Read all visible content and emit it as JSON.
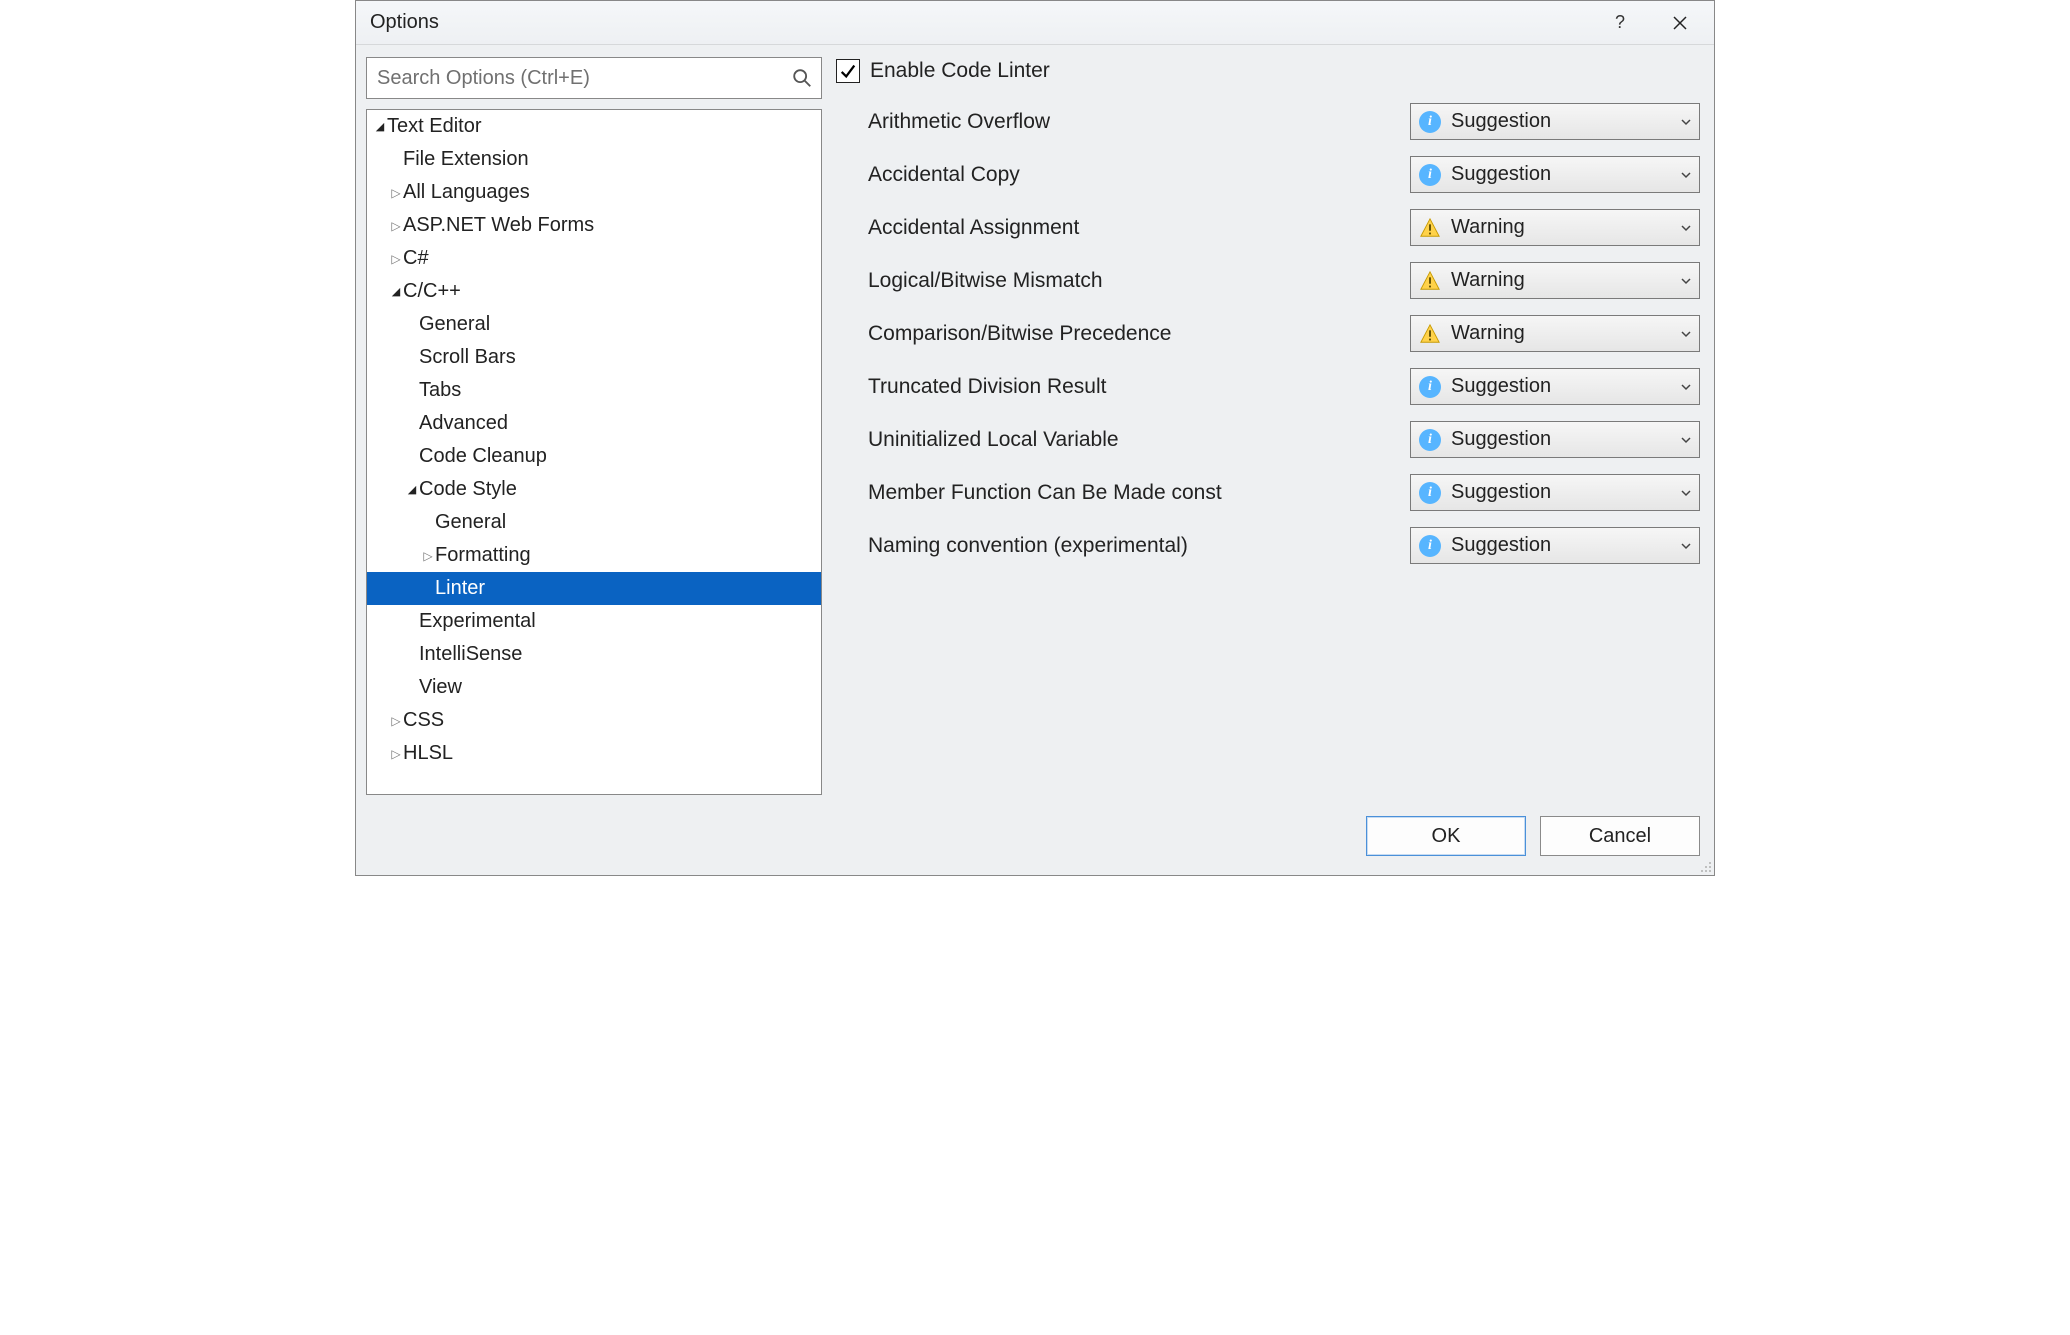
{
  "window": {
    "title": "Options",
    "help_tooltip": "?",
    "close_tooltip": "×"
  },
  "search": {
    "placeholder": "Search Options (Ctrl+E)",
    "value": ""
  },
  "tree": [
    {
      "label": "Text Editor",
      "indent": 0,
      "arrow": "expanded"
    },
    {
      "label": "File Extension",
      "indent": 1,
      "arrow": "none"
    },
    {
      "label": "All Languages",
      "indent": 1,
      "arrow": "collapsed"
    },
    {
      "label": "ASP.NET Web Forms",
      "indent": 1,
      "arrow": "collapsed"
    },
    {
      "label": "C#",
      "indent": 1,
      "arrow": "collapsed"
    },
    {
      "label": "C/C++",
      "indent": 1,
      "arrow": "expanded"
    },
    {
      "label": "General",
      "indent": 2,
      "arrow": "none"
    },
    {
      "label": "Scroll Bars",
      "indent": 2,
      "arrow": "none"
    },
    {
      "label": "Tabs",
      "indent": 2,
      "arrow": "none"
    },
    {
      "label": "Advanced",
      "indent": 2,
      "arrow": "none"
    },
    {
      "label": "Code Cleanup",
      "indent": 2,
      "arrow": "none"
    },
    {
      "label": "Code Style",
      "indent": 2,
      "arrow": "expanded"
    },
    {
      "label": "General",
      "indent": 3,
      "arrow": "none"
    },
    {
      "label": "Formatting",
      "indent": 3,
      "arrow": "collapsed"
    },
    {
      "label": "Linter",
      "indent": 3,
      "arrow": "none",
      "selected": true
    },
    {
      "label": "Experimental",
      "indent": 2,
      "arrow": "none"
    },
    {
      "label": "IntelliSense",
      "indent": 2,
      "arrow": "none"
    },
    {
      "label": "View",
      "indent": 2,
      "arrow": "none"
    },
    {
      "label": "CSS",
      "indent": 1,
      "arrow": "collapsed"
    },
    {
      "label": "HLSL",
      "indent": 1,
      "arrow": "collapsed"
    }
  ],
  "linter": {
    "enable_label": "Enable Code Linter",
    "enable_checked": true,
    "rules": [
      {
        "label": "Arithmetic Overflow",
        "severity": "Suggestion",
        "icon": "info"
      },
      {
        "label": "Accidental Copy",
        "severity": "Suggestion",
        "icon": "info"
      },
      {
        "label": "Accidental Assignment",
        "severity": "Warning",
        "icon": "warn"
      },
      {
        "label": "Logical/Bitwise Mismatch",
        "severity": "Warning",
        "icon": "warn"
      },
      {
        "label": "Comparison/Bitwise Precedence",
        "severity": "Warning",
        "icon": "warn"
      },
      {
        "label": "Truncated Division Result",
        "severity": "Suggestion",
        "icon": "info"
      },
      {
        "label": "Uninitialized Local Variable",
        "severity": "Suggestion",
        "icon": "info"
      },
      {
        "label": "Member Function Can Be Made const",
        "severity": "Suggestion",
        "icon": "info"
      },
      {
        "label": "Naming convention (experimental)",
        "severity": "Suggestion",
        "icon": "info"
      }
    ]
  },
  "buttons": {
    "ok": "OK",
    "cancel": "Cancel"
  }
}
